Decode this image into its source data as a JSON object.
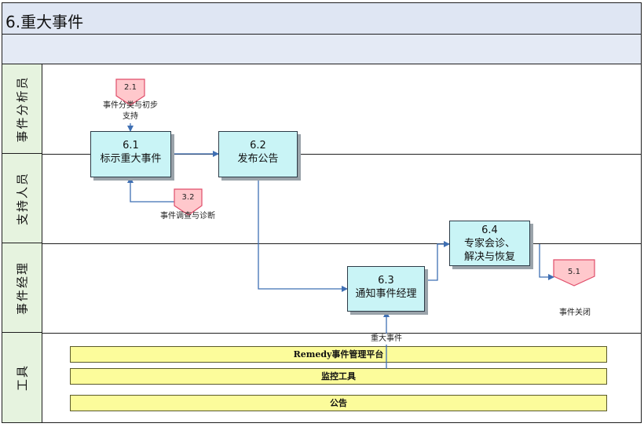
{
  "title": "6.重大事件",
  "lanes": [
    "事件分析员",
    "支持人员",
    "事件经理",
    "工具"
  ],
  "steps": [
    {
      "num": "6.1",
      "label": "标示重大事件"
    },
    {
      "num": "6.2",
      "label": "发布公告"
    },
    {
      "num": "6.3",
      "label": "通知事件经理"
    },
    {
      "num": "6.4",
      "label": "专家会诊、解决与恢复"
    }
  ],
  "connectors": [
    {
      "num": "2.1",
      "label": "事件分类与初步支持"
    },
    {
      "num": "3.2",
      "label": "事件调查与诊断"
    },
    {
      "num": "5.1",
      "label": "事件关闭"
    }
  ],
  "flow_label": "重大事件",
  "tools": [
    "Remedy事件管理平台",
    "监控工具",
    "公告"
  ],
  "colors": {
    "process_box": "#c9f4f6",
    "connector": "#ffc8cc",
    "tool_bar": "#fcfc9b",
    "lane_header": "#e6f3df",
    "arrow": "#3f6fb3"
  }
}
